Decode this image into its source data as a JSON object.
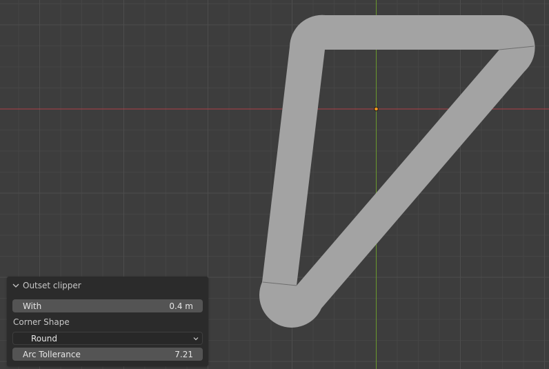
{
  "viewport": {
    "background": "#3d3d3d",
    "grid_color_minor": "#454545",
    "grid_color_major": "#4d4d4d",
    "x_axis_color": "#b04048",
    "y_axis_color": "#6b9a2e",
    "shape_fill": "#a3a3a3",
    "origin_color": "#ff9a1a"
  },
  "panel": {
    "title": "Outset clipper",
    "with_label": "With",
    "with_value": "0.4 m",
    "corner_shape_label": "Corner Shape",
    "corner_shape_value": "Round",
    "arc_tolerance_label": "Arc Tollerance",
    "arc_tolerance_value": "7.21"
  }
}
